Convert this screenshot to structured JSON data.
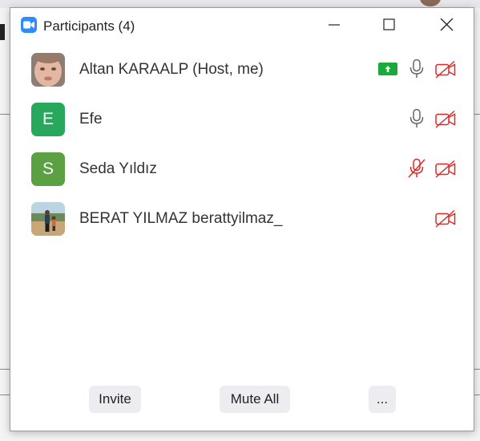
{
  "window": {
    "title": "Participants (4)",
    "controls": [
      "minimize",
      "maximize",
      "close"
    ]
  },
  "participants": [
    {
      "name": "Altan KARAALP (Host, me)",
      "avatar": "photo",
      "sharing": true,
      "mic": "on",
      "video": "off"
    },
    {
      "name": "Efe",
      "avatar": "E",
      "avatar_color": "#27a85d",
      "sharing": false,
      "mic": "on",
      "video": "off"
    },
    {
      "name": "Seda Yıldız",
      "avatar": "S",
      "avatar_color": "#5ba043",
      "sharing": false,
      "mic": "muted",
      "video": "off"
    },
    {
      "name": "BERAT YILMAZ berattyilmaz_",
      "avatar": "photo",
      "sharing": false,
      "mic": "none",
      "video": "off"
    }
  ],
  "footer": {
    "invite_label": "Invite",
    "mute_all_label": "Mute All",
    "more_label": "..."
  },
  "colors": {
    "accent": "#2d8cff",
    "muted_red": "#e02828",
    "share_green": "#1aaa3c"
  }
}
